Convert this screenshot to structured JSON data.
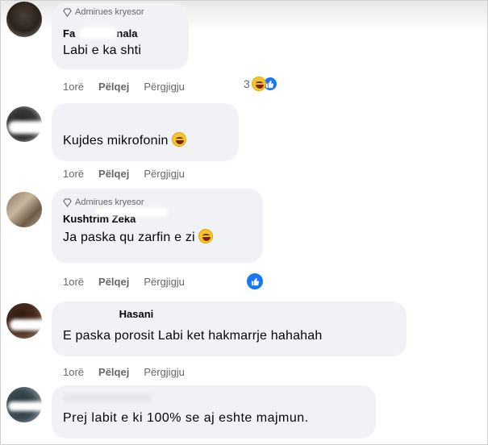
{
  "actions": {
    "time": "1orë",
    "like": "Pëlqej",
    "reply": "Përgjigju"
  },
  "colors": {
    "bubble": "#f0f2f5",
    "like_blue": "#1877f2",
    "meta_gray": "#65676b"
  },
  "comments": [
    {
      "badge": "Admirues kryesor",
      "author": "Fa",
      "author_tail": "nala",
      "text": "Labi e ka shti",
      "reactions": {
        "count": "3",
        "icons": [
          "haha-emoji",
          "like-icon"
        ]
      }
    },
    {
      "badge": "",
      "author": "",
      "text": "Kujdes mikrofonin",
      "text_emoji": "grin-emoji"
    },
    {
      "badge": "Admirues kryesor",
      "author": "Kushtrim Zeka",
      "text": "Ja paska qu zarfin e zi",
      "text_emoji": "haha-emoji",
      "reactions": {
        "count": "",
        "icons": [
          "like-icon"
        ]
      }
    },
    {
      "badge": "",
      "author": "Hasani",
      "text": "E paska porosit Labi ket hakmarrje hahahah"
    },
    {
      "badge": "",
      "author": "",
      "text": "Prej labit e ki 100% se aj eshte majmun."
    }
  ]
}
